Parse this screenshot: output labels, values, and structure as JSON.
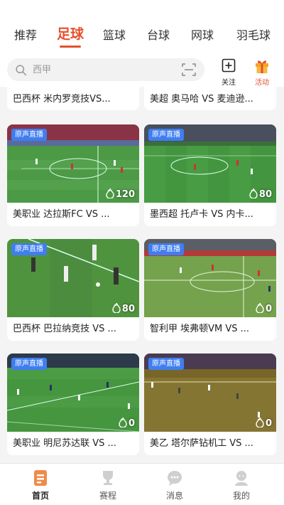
{
  "tabs": [
    {
      "label": "推荐"
    },
    {
      "label": "足球"
    },
    {
      "label": "篮球"
    },
    {
      "label": "台球"
    },
    {
      "label": "网球"
    },
    {
      "label": "羽毛球"
    }
  ],
  "search": {
    "placeholder": "西甲"
  },
  "header_buttons": {
    "follow_label": "关注",
    "activity_label": "活动"
  },
  "top_partial_cards": [
    {
      "title": "巴西杯 米内罗竞技VS..."
    },
    {
      "title": "美超 奥马哈 VS 麦迪逊..."
    }
  ],
  "cards": [
    {
      "badge": "原声直播",
      "heat": "120",
      "title": "美职业 达拉斯FC VS ..."
    },
    {
      "badge": "原声直播",
      "heat": "80",
      "title": "墨西超 托卢卡 VS 内卡..."
    },
    {
      "badge": "原声直播",
      "heat": "80",
      "title": "巴西杯 巴拉纳竞技 VS ..."
    },
    {
      "badge": "原声直播",
      "heat": "0",
      "title": "智利甲 埃弗顿VM VS ..."
    },
    {
      "badge": "原声直播",
      "heat": "0",
      "title": "美职业 明尼苏达联 VS ..."
    },
    {
      "badge": "原声直播",
      "heat": "0",
      "title": "美乙 塔尔萨钻机工 VS ..."
    }
  ],
  "bottom_nav": [
    {
      "label": "首页",
      "icon": "home-icon"
    },
    {
      "label": "赛程",
      "icon": "schedule-icon"
    },
    {
      "label": "消息",
      "icon": "message-icon"
    },
    {
      "label": "我的",
      "icon": "profile-icon"
    }
  ],
  "colors": {
    "accent": "#e5502b",
    "badge": "#3f7ef0",
    "activity": "#f5a623"
  }
}
